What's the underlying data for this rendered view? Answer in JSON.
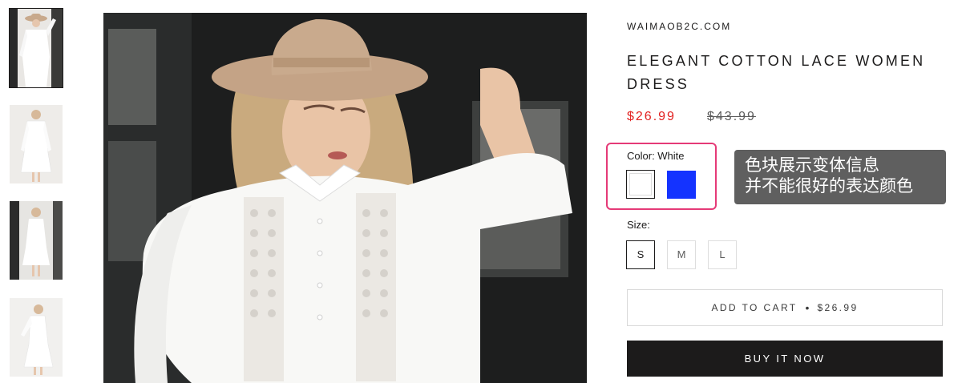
{
  "store": {
    "vendor": "WAIMAOB2C.COM"
  },
  "product": {
    "title": "ELEGANT COTTON LACE WOMEN DRESS",
    "price_sale": "$26.99",
    "price_compare": "$43.99"
  },
  "gallery": {
    "thumbnails": [
      {
        "icon": "dress-front-hat-thumbnail",
        "active": true
      },
      {
        "icon": "dress-back-view-thumbnail",
        "active": false
      },
      {
        "icon": "dress-full-length-thumbnail",
        "active": false
      },
      {
        "icon": "dress-outdoor-thumbnail",
        "active": false
      }
    ],
    "main_image": "model-white-lace-dress-beige-hat"
  },
  "options": {
    "color_label": "Color: White",
    "colors": [
      {
        "name": "White",
        "hex": "#ffffff",
        "selected": true
      },
      {
        "name": "Blue",
        "hex": "#1433ff",
        "selected": false
      }
    ],
    "size_label": "Size:",
    "sizes": [
      {
        "label": "S",
        "selected": true
      },
      {
        "label": "M",
        "selected": false
      },
      {
        "label": "L",
        "selected": false
      }
    ]
  },
  "annotation": {
    "line1": "色块展示变体信息",
    "line2": "并不能很好的表达颜色",
    "highlight_color": "#e53a77"
  },
  "buttons": {
    "add_to_cart_label": "ADD TO CART",
    "add_to_cart_separator": "•",
    "add_to_cart_price": "$26.99",
    "buy_now_label": "BUY IT NOW"
  },
  "colors": {
    "sale_price": "#e22120",
    "primary_button": "#1c1b1b",
    "annotation_bg": "#5f5f5f"
  }
}
